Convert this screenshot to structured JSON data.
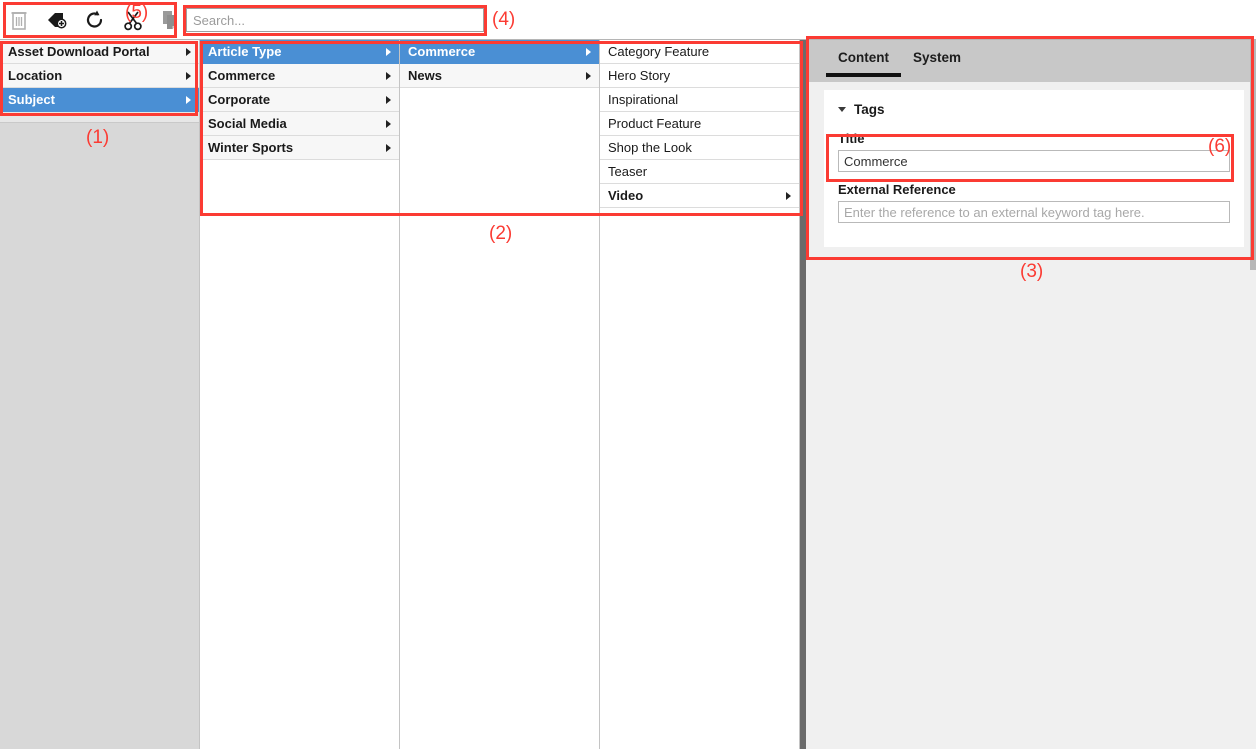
{
  "toolbar": {
    "icons": [
      {
        "name": "delete-icon",
        "title": "Delete"
      },
      {
        "name": "add-tag-icon",
        "title": "Add Tag"
      },
      {
        "name": "refresh-icon",
        "title": "Refresh"
      },
      {
        "name": "cut-icon",
        "title": "Cut"
      },
      {
        "name": "paste-icon",
        "title": "Paste"
      }
    ]
  },
  "search": {
    "placeholder": "Search...",
    "value": ""
  },
  "columns": [
    {
      "name": "column-taxonomies",
      "background": "#d8d8d8",
      "items": [
        {
          "label": "Asset Download Portal",
          "selected": false,
          "bold": true,
          "arrow": true
        },
        {
          "label": "Location",
          "selected": false,
          "bold": true,
          "arrow": true
        },
        {
          "label": "Subject",
          "selected": true,
          "bold": true,
          "arrow": true
        }
      ]
    },
    {
      "name": "column-subject",
      "background": "#ffffff",
      "items": [
        {
          "label": "Article Type",
          "selected": true,
          "bold": true,
          "arrow": true
        },
        {
          "label": "Commerce",
          "selected": false,
          "bold": true,
          "arrow": true
        },
        {
          "label": "Corporate",
          "selected": false,
          "bold": true,
          "arrow": true
        },
        {
          "label": "Social Media",
          "selected": false,
          "bold": true,
          "arrow": true
        },
        {
          "label": "Winter Sports",
          "selected": false,
          "bold": true,
          "arrow": true
        }
      ]
    },
    {
      "name": "column-article-type",
      "background": "#ffffff",
      "items": [
        {
          "label": "Commerce",
          "selected": true,
          "bold": true,
          "arrow": true
        },
        {
          "label": "News",
          "selected": false,
          "bold": true,
          "arrow": true
        }
      ]
    },
    {
      "name": "column-commerce",
      "background": "#ffffff",
      "items": [
        {
          "label": "Category Feature",
          "selected": false,
          "bold": false,
          "arrow": false
        },
        {
          "label": "Hero Story",
          "selected": false,
          "bold": false,
          "arrow": false
        },
        {
          "label": "Inspirational",
          "selected": false,
          "bold": false,
          "arrow": false
        },
        {
          "label": "Product Feature",
          "selected": false,
          "bold": false,
          "arrow": false
        },
        {
          "label": "Shop the Look",
          "selected": false,
          "bold": false,
          "arrow": false
        },
        {
          "label": "Teaser",
          "selected": false,
          "bold": false,
          "arrow": false
        },
        {
          "label": "Video",
          "selected": false,
          "bold": true,
          "arrow": true
        }
      ]
    }
  ],
  "right_panel": {
    "tabs": [
      {
        "label": "Content",
        "active": true
      },
      {
        "label": "System",
        "active": false
      }
    ],
    "section": {
      "title": "Tags",
      "expanded": true
    },
    "fields": [
      {
        "name": "title",
        "label": "Title",
        "value": "Commerce",
        "placeholder": ""
      },
      {
        "name": "external-reference",
        "label": "External Reference",
        "value": "",
        "placeholder": "Enter the reference to an external keyword tag here."
      }
    ]
  },
  "annotations": {
    "accent_color": "#fb3b33",
    "labels": [
      {
        "id": "1",
        "text": "(1)"
      },
      {
        "id": "2",
        "text": "(2)"
      },
      {
        "id": "3",
        "text": "(3)"
      },
      {
        "id": "4",
        "text": "(4)"
      },
      {
        "id": "5",
        "text": "(5)"
      },
      {
        "id": "6",
        "text": "(6)"
      }
    ]
  },
  "colors": {
    "selection_blue": "#4a8fd4",
    "tabbar_gray": "#c8c8c8",
    "panel_gray": "#f0f0f0",
    "column1_gray": "#d8d8d8"
  }
}
